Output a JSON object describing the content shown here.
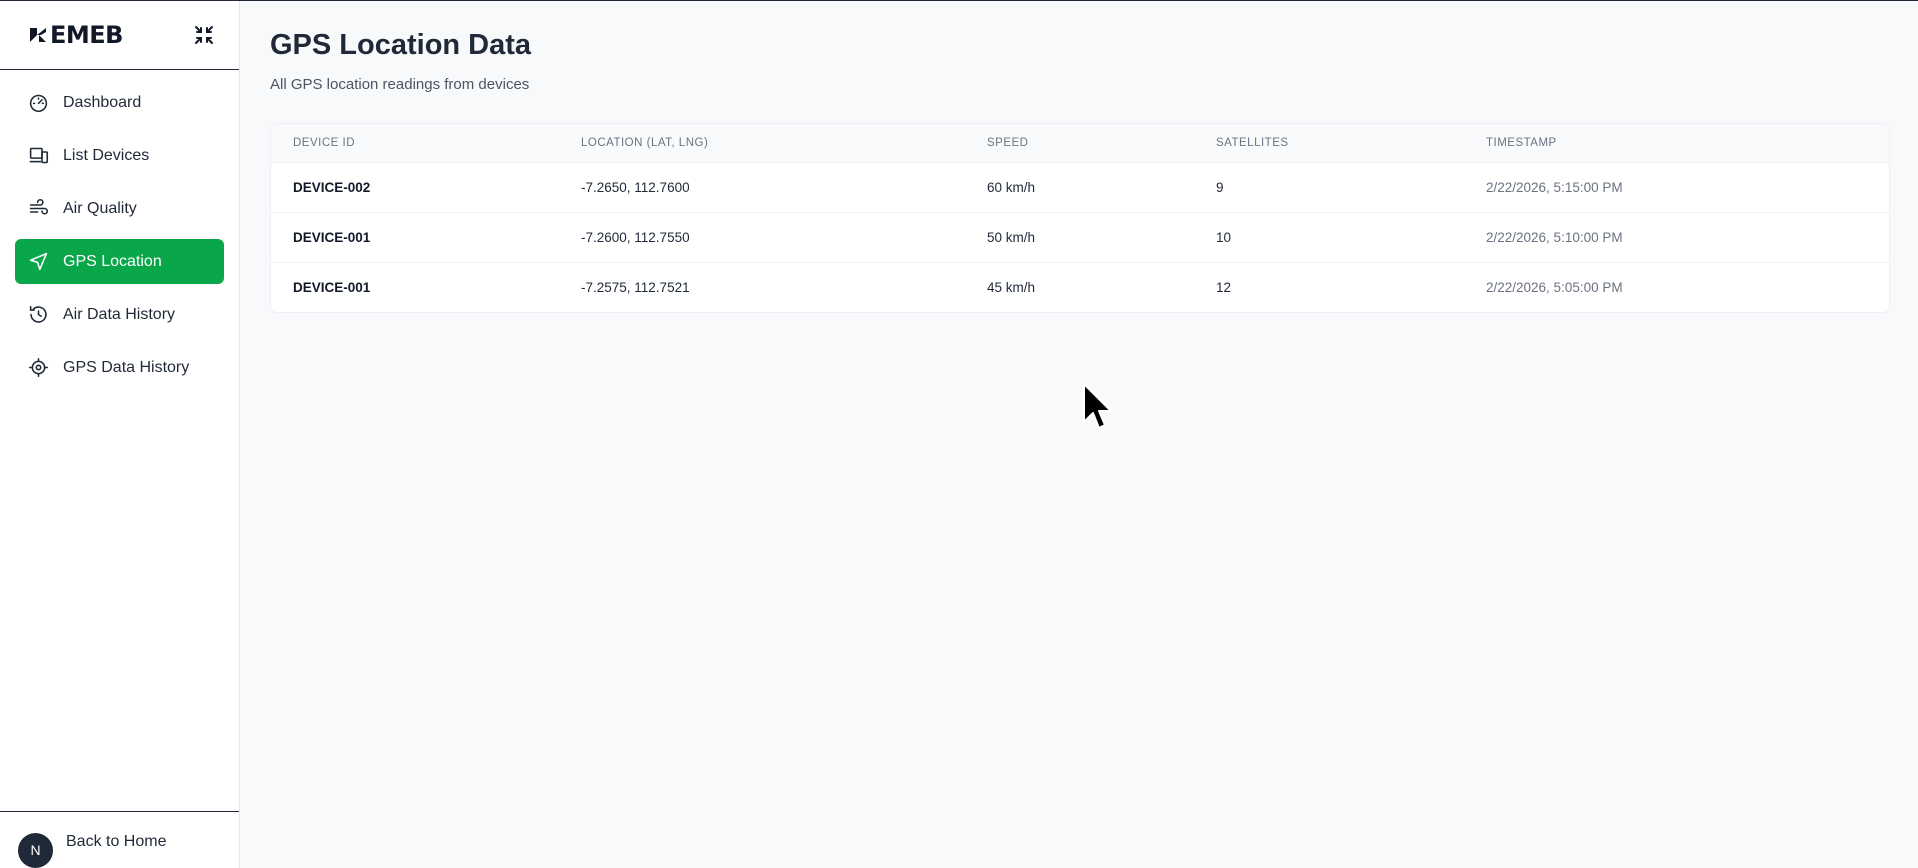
{
  "sidebar": {
    "logo_text": "EMEB",
    "items": [
      {
        "label": "Dashboard",
        "icon": "gauge-icon",
        "active": false
      },
      {
        "label": "List Devices",
        "icon": "devices-icon",
        "active": false
      },
      {
        "label": "Air Quality",
        "icon": "wind-icon",
        "active": false
      },
      {
        "label": "GPS Location",
        "icon": "navigation-icon",
        "active": true
      },
      {
        "label": "Air Data History",
        "icon": "history-icon",
        "active": false
      },
      {
        "label": "GPS Data History",
        "icon": "locate-icon",
        "active": false
      }
    ],
    "footer": {
      "avatar_letter": "N",
      "label": "Back to Home"
    }
  },
  "main": {
    "title": "GPS Location Data",
    "subtitle": "All GPS location readings from devices",
    "table": {
      "columns": [
        "Device ID",
        "Location (Lat, Lng)",
        "Speed",
        "Satellites",
        "Timestamp"
      ],
      "rows": [
        [
          "DEVICE-002",
          "-7.2650, 112.7600",
          "60 km/h",
          "9",
          "2/22/2026, 5:15:00 PM"
        ],
        [
          "DEVICE-001",
          "-7.2600, 112.7550",
          "50 km/h",
          "10",
          "2/22/2026, 5:10:00 PM"
        ],
        [
          "DEVICE-001",
          "-7.2575, 112.7521",
          "45 km/h",
          "12",
          "2/22/2026, 5:05:00 PM"
        ]
      ]
    }
  },
  "colors": {
    "accent": "#0aa64a",
    "text": "#1f2937",
    "muted": "#6b7280",
    "background": "#f8f9fb"
  }
}
